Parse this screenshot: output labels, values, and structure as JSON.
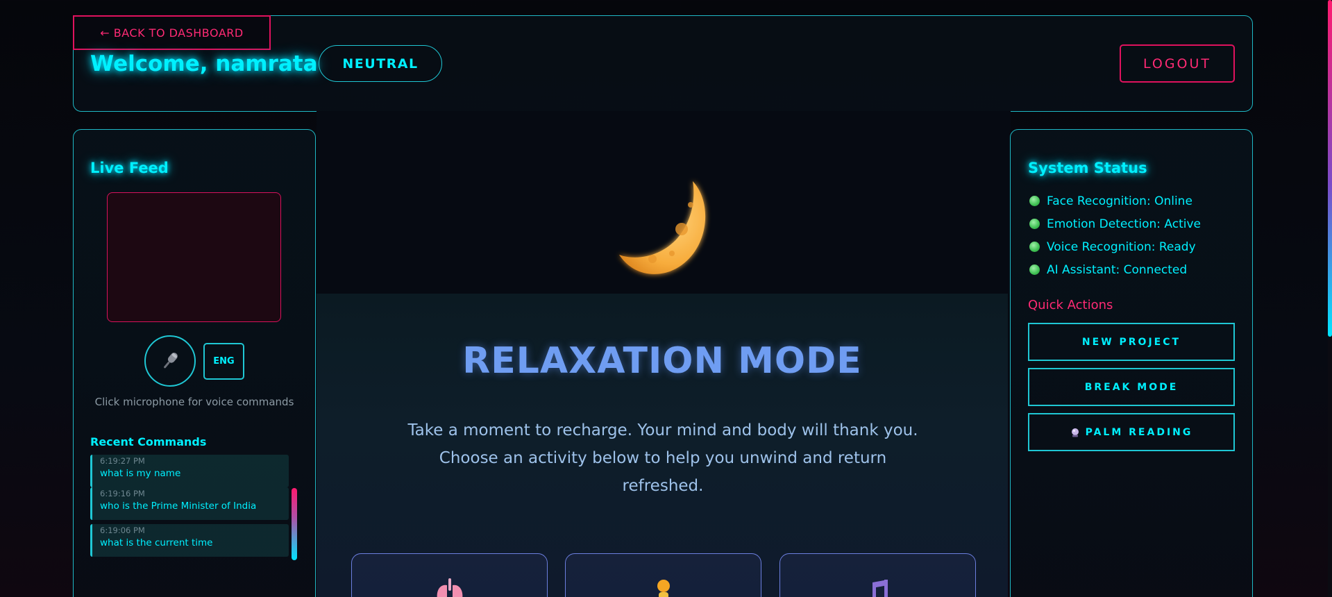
{
  "header": {
    "back_label": "← BACK TO DASHBOARD",
    "welcome_text": "Welcome, namrata",
    "mood_badge": "NEUTRAL",
    "logout_label": "LOGOUT"
  },
  "live_feed": {
    "title": "Live Feed",
    "mic_hint": "Click microphone for voice commands",
    "lang_label": "ENG",
    "recent_title": "Recent Commands",
    "commands": [
      {
        "time": "6:19:27 PM",
        "text": "what is my name"
      },
      {
        "time": "6:19:16 PM",
        "text": "who is the Prime Minister of India"
      },
      {
        "time": "6:19:06 PM",
        "text": "what is the current time"
      }
    ]
  },
  "main": {
    "icon": "crescent-moon-icon",
    "title": "RELAXATION MODE",
    "description": "Take a moment to recharge. Your mind and body will thank you. Choose an activity below to help you unwind and return refreshed.",
    "activities": [
      {
        "icon": "lungs-icon"
      },
      {
        "icon": "person-meditating-icon"
      },
      {
        "icon": "music-note-icon"
      }
    ]
  },
  "system_status": {
    "title": "System Status",
    "items": [
      {
        "label": "Face Recognition: Online"
      },
      {
        "label": "Emotion Detection: Active"
      },
      {
        "label": "Voice Recognition: Ready"
      },
      {
        "label": "AI Assistant: Connected"
      }
    ],
    "quick_actions_title": "Quick Actions",
    "actions": [
      {
        "label": "NEW PROJECT"
      },
      {
        "label": "BREAK MODE"
      },
      {
        "label": "PALM READING",
        "icon": "crystal-ball-icon"
      }
    ]
  },
  "colors": {
    "accent_cyan": "#00f0ff",
    "accent_pink": "#ff2a74",
    "title_blue": "#6f9df2"
  }
}
